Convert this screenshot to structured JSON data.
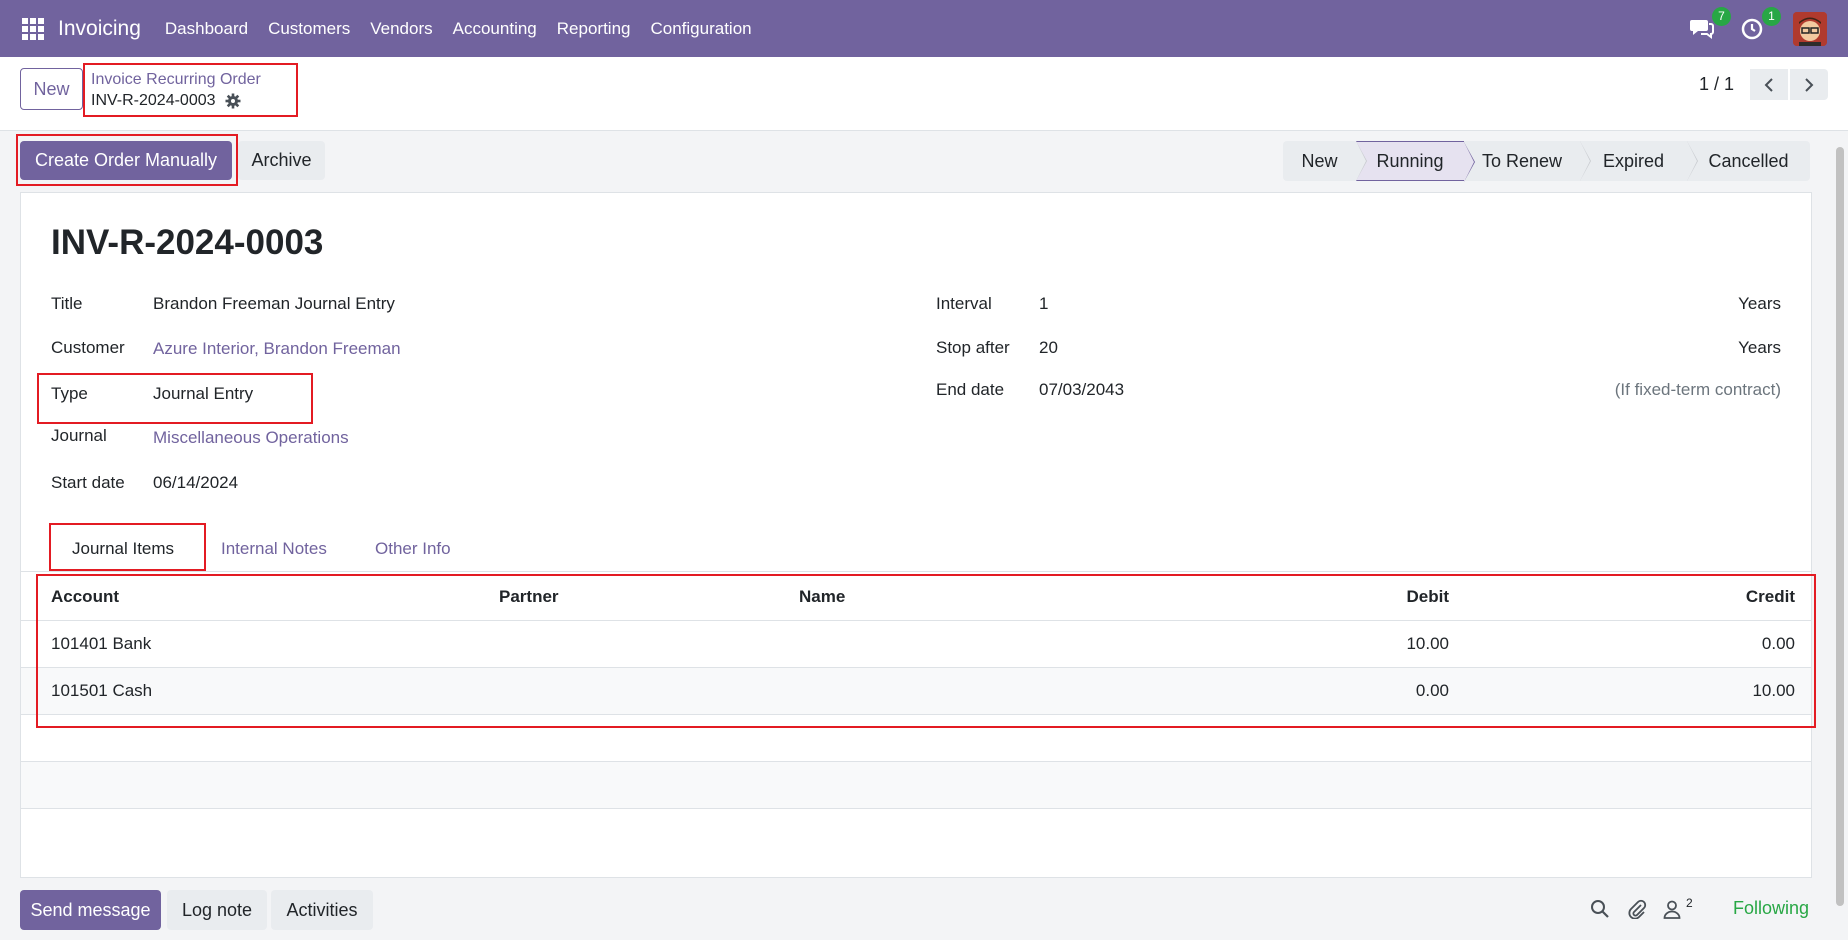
{
  "navbar": {
    "app_name": "Invoicing",
    "menu": [
      "Dashboard",
      "Customers",
      "Vendors",
      "Accounting",
      "Reporting",
      "Configuration"
    ],
    "messages_badge": "7",
    "activities_badge": "1"
  },
  "control_panel": {
    "new_label": "New",
    "breadcrumb_parent": "Invoice Recurring Order",
    "breadcrumb_current": "INV-R-2024-0003",
    "pager": "1 / 1"
  },
  "actions": {
    "create_order": "Create Order Manually",
    "archive": "Archive"
  },
  "status_stages": [
    "New",
    "Running",
    "To Renew",
    "Expired",
    "Cancelled"
  ],
  "status_current": "Running",
  "form": {
    "record_name": "INV-R-2024-0003",
    "left_fields": [
      {
        "label": "Title",
        "value": "Brandon Freeman Journal Entry"
      },
      {
        "label": "Customer",
        "value": "Azure Interior, Brandon Freeman"
      },
      {
        "label": "Type",
        "value": "Journal Entry"
      },
      {
        "label": "Journal",
        "value": "Miscellaneous Operations"
      },
      {
        "label": "Start date",
        "value": "06/14/2024"
      }
    ],
    "right_fields": [
      {
        "label": "Interval",
        "value": "1",
        "suffix": "Years"
      },
      {
        "label": "Stop after",
        "value": "20",
        "suffix": "Years"
      },
      {
        "label": "End date",
        "value": "07/03/2043",
        "suffix": "(If fixed-term contract)"
      }
    ]
  },
  "tabs": [
    "Journal Items",
    "Internal Notes",
    "Other Info"
  ],
  "table": {
    "columns": [
      "Account",
      "Partner",
      "Name",
      "Debit",
      "Credit"
    ],
    "rows": [
      {
        "account": "101401 Bank",
        "partner": "",
        "name": "",
        "debit": "10.00",
        "credit": "0.00"
      },
      {
        "account": "101501 Cash",
        "partner": "",
        "name": "",
        "debit": "0.00",
        "credit": "10.00"
      }
    ]
  },
  "chatter": {
    "send_message": "Send message",
    "log_note": "Log note",
    "activities": "Activities",
    "followers_count": "2",
    "following": "Following"
  },
  "colors": {
    "brand": "#71639e",
    "highlight": "#e31b23",
    "following": "#28a745"
  }
}
